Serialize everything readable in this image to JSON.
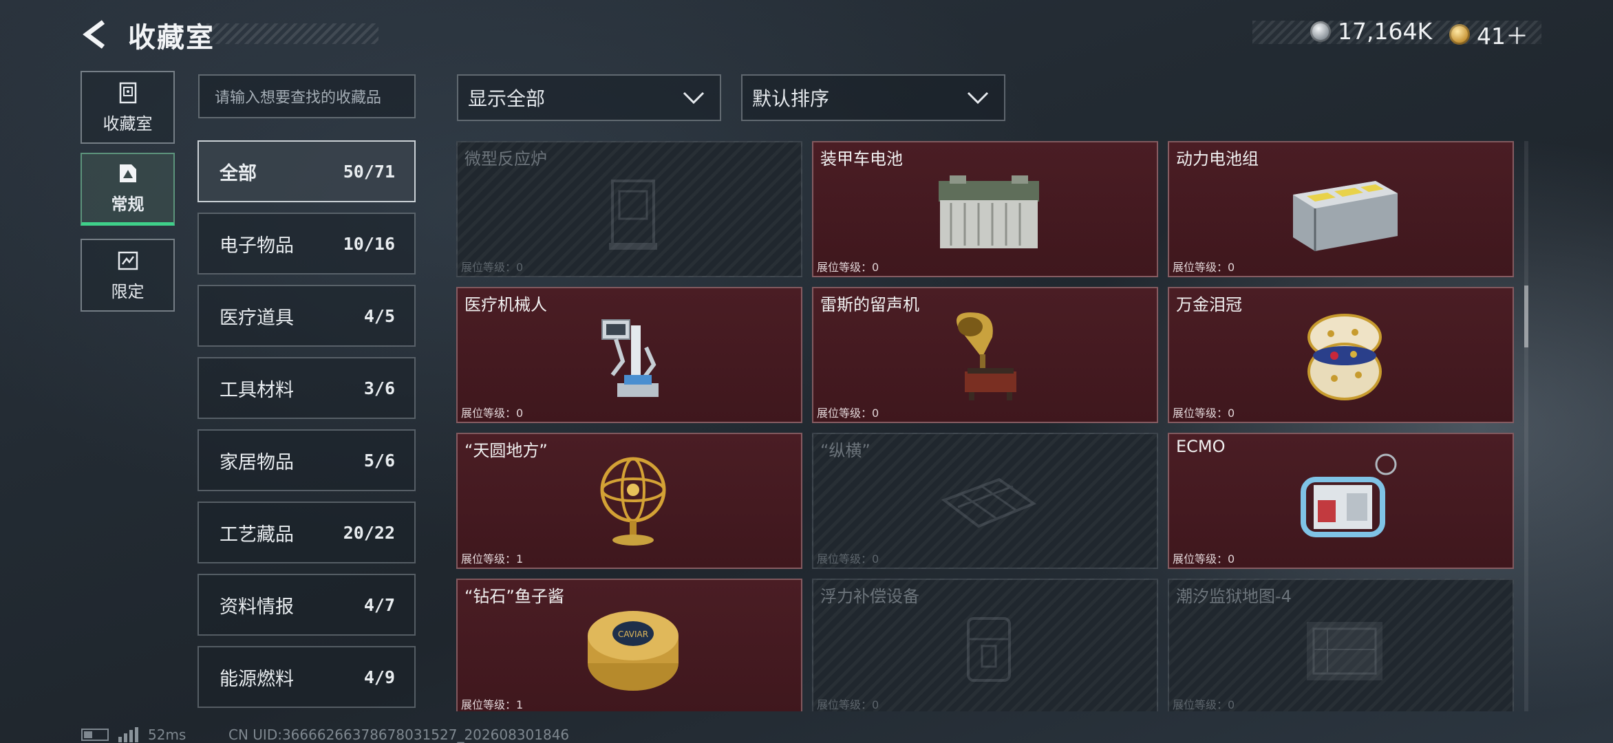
{
  "header": {
    "title": "收藏室",
    "currency": [
      {
        "icon": "silver-coin-icon",
        "value": "17,164K"
      },
      {
        "icon": "gold-coin-icon",
        "value": "41＋"
      }
    ]
  },
  "modes": [
    {
      "label": "收藏室",
      "icon": "cabinet-icon",
      "active": false
    },
    {
      "label": "常规",
      "icon": "collection-icon",
      "active": true
    },
    {
      "label": "限定",
      "icon": "limited-icon",
      "active": false
    }
  ],
  "search": {
    "placeholder": "请输入想要查找的收藏品"
  },
  "categories": [
    {
      "label": "全部",
      "count": "50/71",
      "active": true
    },
    {
      "label": "电子物品",
      "count": "10/16"
    },
    {
      "label": "医疗道具",
      "count": "4/5"
    },
    {
      "label": "工具材料",
      "count": "3/6"
    },
    {
      "label": "家居物品",
      "count": "5/6"
    },
    {
      "label": "工艺藏品",
      "count": "20/22"
    },
    {
      "label": "资料情报",
      "count": "4/7"
    },
    {
      "label": "能源燃料",
      "count": "4/9"
    }
  ],
  "filters": {
    "display": "显示全部",
    "sort": "默认排序"
  },
  "level_label": "展位等级：",
  "items": [
    {
      "name": "微型反应炉",
      "level": "0",
      "collected": false,
      "icon": "reactor-icon"
    },
    {
      "name": "装甲车电池",
      "level": "0",
      "collected": true,
      "icon": "vehicle-battery-icon"
    },
    {
      "name": "动力电池组",
      "level": "0",
      "collected": true,
      "icon": "battery-pack-icon"
    },
    {
      "name": "医疗机械人",
      "level": "0",
      "collected": true,
      "icon": "medical-robot-icon"
    },
    {
      "name": "雷斯的留声机",
      "level": "0",
      "collected": true,
      "icon": "gramophone-icon"
    },
    {
      "name": "万金泪冠",
      "level": "0",
      "collected": true,
      "icon": "jeweled-egg-icon"
    },
    {
      "name": "“天圆地方”",
      "level": "1",
      "collected": true,
      "icon": "armillary-sphere-icon"
    },
    {
      "name": "“纵横”",
      "level": "0",
      "collected": false,
      "icon": "chessboard-icon"
    },
    {
      "name": "ECMO",
      "level": "0",
      "collected": true,
      "icon": "ecmo-machine-icon"
    },
    {
      "name": "“钻石”鱼子酱",
      "level": "1",
      "collected": true,
      "icon": "caviar-tin-icon"
    },
    {
      "name": "浮力补偿设备",
      "level": "0",
      "collected": false,
      "icon": "buoyancy-device-icon"
    },
    {
      "name": "潮汐监狱地图-4",
      "level": "0",
      "collected": false,
      "icon": "map-icon"
    }
  ],
  "status": {
    "ping": "52ms",
    "uid": "CN UID:3666626637867803152​7_202608301846"
  }
}
